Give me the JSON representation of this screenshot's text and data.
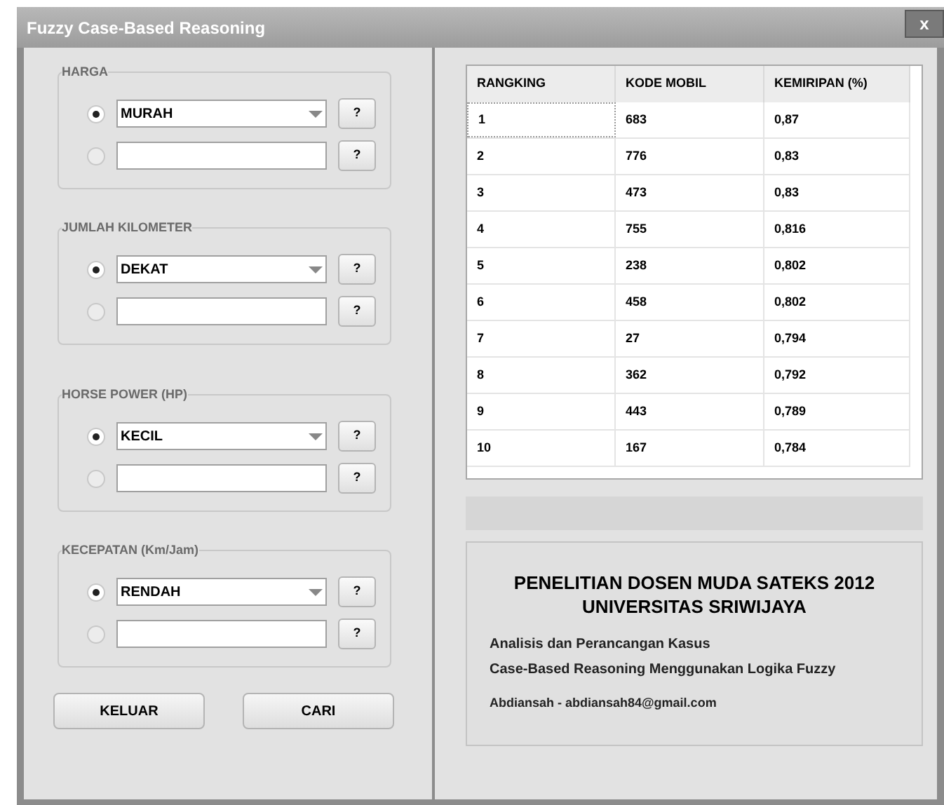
{
  "window": {
    "title": "Fuzzy Case-Based Reasoning",
    "close": "x"
  },
  "groups": [
    {
      "label": "HARGA",
      "options": [
        {
          "kind": "combo",
          "value": "MURAH",
          "selected": true,
          "help": "?"
        },
        {
          "kind": "text",
          "selected": false,
          "help": "?"
        }
      ]
    },
    {
      "label": "JUMLAH KILOMETER",
      "options": [
        {
          "kind": "combo",
          "value": "DEKAT",
          "selected": true,
          "help": "?"
        },
        {
          "kind": "text",
          "selected": false,
          "help": "?"
        }
      ]
    },
    {
      "label": "HORSE POWER (HP)",
      "options": [
        {
          "kind": "combo",
          "value": "KECIL",
          "selected": true,
          "help": "?"
        },
        {
          "kind": "text",
          "selected": false,
          "help": "?"
        }
      ]
    },
    {
      "label": "KECEPATAN (Km/Jam)",
      "options": [
        {
          "kind": "combo",
          "value": "RENDAH",
          "selected": true,
          "help": "?"
        },
        {
          "kind": "text",
          "selected": false,
          "help": "?"
        }
      ]
    }
  ],
  "buttons": [
    "KELUAR",
    "CARI"
  ],
  "table": {
    "columns": [
      "RANGKING",
      "KODE MOBIL",
      "KEMIRIPAN (%)"
    ],
    "rows": [
      {
        "cells": [
          "1",
          "683",
          "0,87"
        ],
        "focused": true
      },
      {
        "cells": [
          "2",
          "776",
          "0,83"
        ],
        "focused": false
      },
      {
        "cells": [
          "3",
          "473",
          "0,83"
        ],
        "focused": false
      },
      {
        "cells": [
          "4",
          "755",
          "0,816"
        ],
        "focused": false
      },
      {
        "cells": [
          "5",
          "238",
          "0,802"
        ],
        "focused": false
      },
      {
        "cells": [
          "6",
          "458",
          "0,802"
        ],
        "focused": false
      },
      {
        "cells": [
          "7",
          "27",
          "0,794"
        ],
        "focused": false
      },
      {
        "cells": [
          "8",
          "362",
          "0,792"
        ],
        "focused": false
      },
      {
        "cells": [
          "9",
          "443",
          "0,789"
        ],
        "focused": false
      },
      {
        "cells": [
          "10",
          "167",
          "0,784"
        ],
        "focused": false
      }
    ]
  },
  "info": {
    "title_lines": [
      "PENELITIAN DOSEN MUDA SATEKS 2012",
      "UNIVERSITAS SRIWIJAYA"
    ],
    "description_lines": [
      "Analisis dan Perancangan Kasus",
      "Case-Based Reasoning Menggunakan Logika Fuzzy"
    ],
    "author": "Abdiansah - abdiansah84@gmail.com"
  }
}
